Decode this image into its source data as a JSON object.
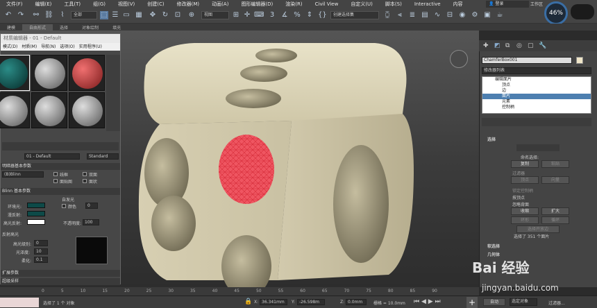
{
  "menubar": {
    "items": [
      "文件(F)",
      "编辑(E)",
      "工具(T)",
      "组(G)",
      "视图(V)",
      "创建(C)",
      "修改器(M)",
      "动画(A)",
      "图形编辑器(D)",
      "渲染(R)",
      "Civil View",
      "自定义(U)",
      "脚本(S)",
      "Interactive",
      "内容"
    ],
    "user": "登录",
    "workspace": "工作区"
  },
  "toolbar": {
    "selection_filter": "全部",
    "view_dropdown": "视图",
    "named_selection": "创建选择集",
    "zoom_level": "46%"
  },
  "subbar": {
    "items": [
      "建模",
      "自由形式",
      "选择",
      "对象绘制",
      "填充"
    ]
  },
  "material_editor": {
    "title": "材质编辑器 - 01 - Default",
    "menu": [
      "模式(D)",
      "材质(M)",
      "导航(N)",
      "选项(O)",
      "实用程序(U)"
    ],
    "material_name": "01 - Default",
    "material_type": "Standard",
    "rollout_basic": "明暗器基本参数",
    "shader": "(B)Blinn",
    "shader_opts": [
      "线框",
      "双面",
      "面贴图",
      "面状"
    ],
    "rollout_blinn": "Blinn 基本参数",
    "ambient": "环境光:",
    "diffuse": "漫反射:",
    "specular": "高光反射:",
    "self_illum": "自发光",
    "color": "颜色",
    "self_illum_val": "0",
    "opacity": "不透明度:",
    "opacity_val": "100",
    "spec_highlights": "反射高光",
    "spec_level": "高光级别:",
    "spec_level_val": "0",
    "glossiness": "光泽度:",
    "glossiness_val": "10",
    "soften": "柔化:",
    "soften_val": "0.1",
    "rollout_ext": "扩展参数",
    "rollout_ss": "超级采样",
    "colors": {
      "ambient": "#0d4a48",
      "diffuse": "#0d4a48",
      "specular": "#ffffff",
      "slot1": "#0b4d4a",
      "slot3": "#c0392b"
    }
  },
  "command_panel": {
    "object_name": "ChamferBox001",
    "modifier_list": "修改器列表",
    "stack": [
      "编辑面片",
      "顶点",
      "边",
      "面片",
      "元素",
      "控制柄"
    ],
    "rollout_select": "选择",
    "named_selections": "命名选择:",
    "copy": "复制",
    "paste": "粘贴",
    "filter": "过滤器",
    "vertex": "顶点",
    "vector": "向量",
    "lock_handles": "锁定控制柄",
    "by_vertex": "按顶点",
    "ignore_backfacing": "忽略背面",
    "shrink": "收缩",
    "grow": "扩大",
    "ring": "环形",
    "loop": "循环",
    "select_open_edges": "选择开放边",
    "selected_count": "选择了 351 个面片",
    "rollout_soft": "软选择",
    "rollout_geom": "几何体"
  },
  "status": {
    "selected": "选择了 1 个 对象",
    "x_label": "X:",
    "x_val": "36.341mm",
    "y_label": "Y:",
    "y_val": "-26.598m",
    "z_label": "Z:",
    "z_val": "0.0mm",
    "grid": "栅格 = 10.0mm",
    "auto": "自动",
    "selected_obj": "选定对象",
    "filters": "过滤器...",
    "timeline": [
      "0",
      "5",
      "10",
      "15",
      "20",
      "25",
      "30",
      "35",
      "40",
      "45",
      "50",
      "55",
      "60",
      "65",
      "70",
      "75",
      "80",
      "85",
      "90"
    ]
  },
  "watermark": {
    "brand": "Bai 经验",
    "url": "jingyan.baidu.com"
  }
}
